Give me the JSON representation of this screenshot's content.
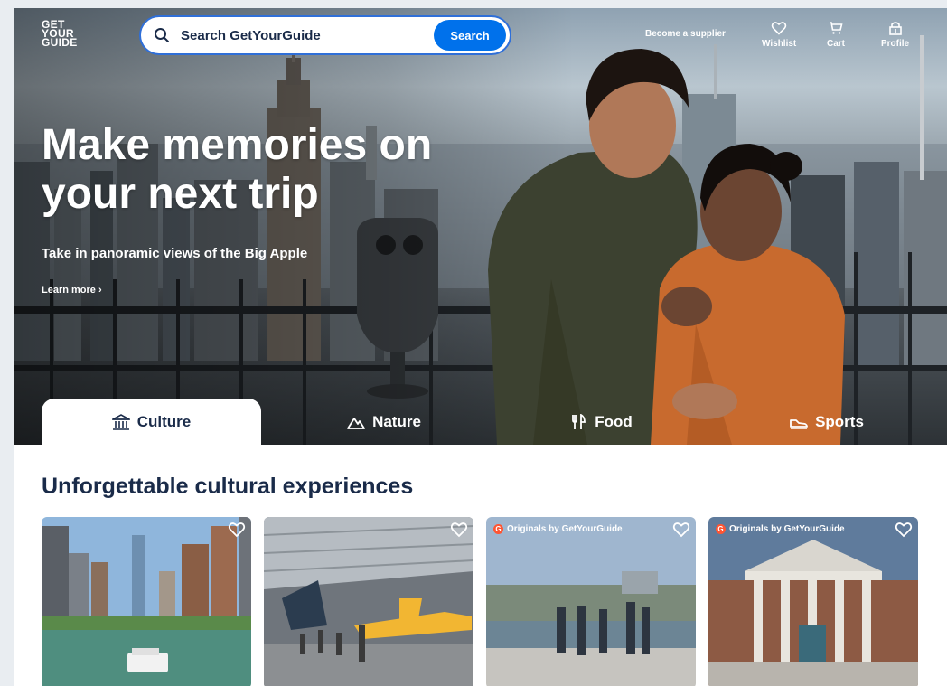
{
  "logo": {
    "line1": "GET",
    "line2": "YOUR",
    "line3": "GUIDE"
  },
  "search": {
    "placeholder": "Search GetYourGuide",
    "button_label": "Search"
  },
  "nav": {
    "supplier": "Become a supplier",
    "wishlist": "Wishlist",
    "cart": "Cart",
    "profile": "Profile"
  },
  "hero": {
    "headline_line1": "Make memories on",
    "headline_line2": "your next trip",
    "subline": "Take in panoramic views of the Big Apple",
    "learn_more": "Learn more ›"
  },
  "tabs": [
    {
      "label": "Culture",
      "icon": "museum-icon",
      "active": true
    },
    {
      "label": "Nature",
      "icon": "mountain-icon",
      "active": false
    },
    {
      "label": "Food",
      "icon": "fork-knife-icon",
      "active": false
    },
    {
      "label": "Sports",
      "icon": "sneaker-icon",
      "active": false
    }
  ],
  "section": {
    "title": "Unforgettable cultural experiences"
  },
  "cards": [
    {
      "badge": ""
    },
    {
      "badge": ""
    },
    {
      "badge": "Originals by GetYourGuide"
    },
    {
      "badge": "Originals by GetYourGuide"
    }
  ],
  "colors": {
    "brand_blue": "#0071eb",
    "navy": "#1a2b49",
    "originals_orange": "#ff5533"
  }
}
